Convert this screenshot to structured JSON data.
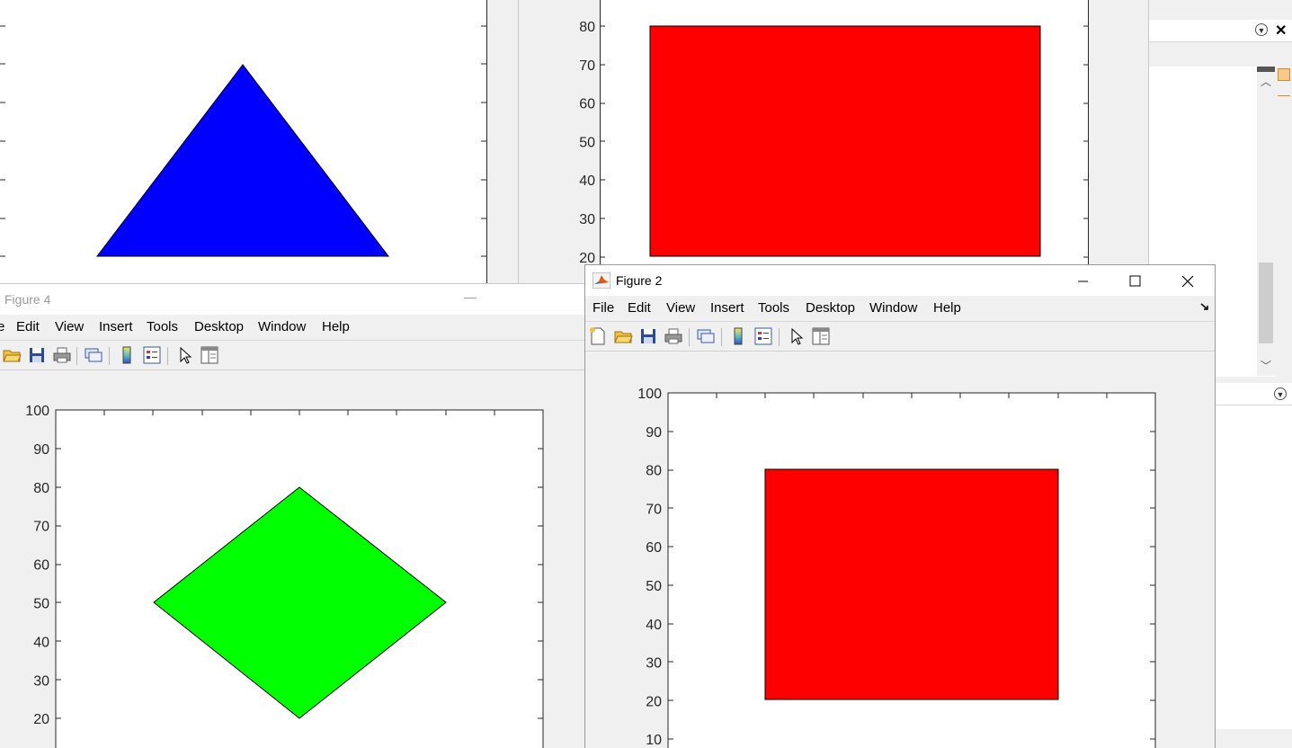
{
  "figure4": {
    "title": "Figure 4",
    "menu": [
      "Edit",
      "View",
      "Insert",
      "Tools",
      "Desktop",
      "Window",
      "Help"
    ],
    "menu_partial": "e",
    "minimize_glyph": "—"
  },
  "figure2": {
    "title": "Figure 2",
    "menu": [
      "File",
      "Edit",
      "View",
      "Insert",
      "Tools",
      "Desktop",
      "Window",
      "Help"
    ]
  },
  "chart_data": [
    {
      "type": "area",
      "name": "top-left-figure",
      "polygon": {
        "x": [
          -6,
          0,
          6
        ],
        "y": [
          20,
          70,
          20
        ],
        "color": "#0000ff"
      },
      "yticks": []
    },
    {
      "type": "area",
      "name": "top-middle-figure",
      "polygon": {
        "x": [
          20,
          80,
          80,
          20
        ],
        "y": [
          20,
          20,
          80,
          80
        ],
        "color": "#ff0000"
      },
      "yticks": [
        "80",
        "70",
        "60",
        "50",
        "40",
        "30",
        "20"
      ],
      "partial_tick": "1"
    },
    {
      "type": "area",
      "name": "figure4",
      "polygon": {
        "x": [
          50,
          80,
          50,
          20
        ],
        "y": [
          20,
          50,
          80,
          50
        ],
        "color": "#00ff00"
      },
      "yticks": [
        "100",
        "90",
        "80",
        "70",
        "60",
        "50",
        "40",
        "30",
        "20"
      ],
      "ylim": [
        10,
        100
      ]
    },
    {
      "type": "area",
      "name": "figure2",
      "polygon": {
        "x": [
          20,
          80,
          80,
          20
        ],
        "y": [
          20,
          20,
          80,
          80
        ],
        "color": "#ff0000"
      },
      "yticks": [
        "100",
        "90",
        "80",
        "70",
        "60",
        "50",
        "40",
        "30",
        "20",
        "10"
      ],
      "ylim": [
        10,
        100
      ]
    }
  ],
  "colors": {
    "blue": "#0000ff",
    "red": "#ff0000",
    "green": "#00ff00",
    "window_bg": "#f0f0f0"
  }
}
